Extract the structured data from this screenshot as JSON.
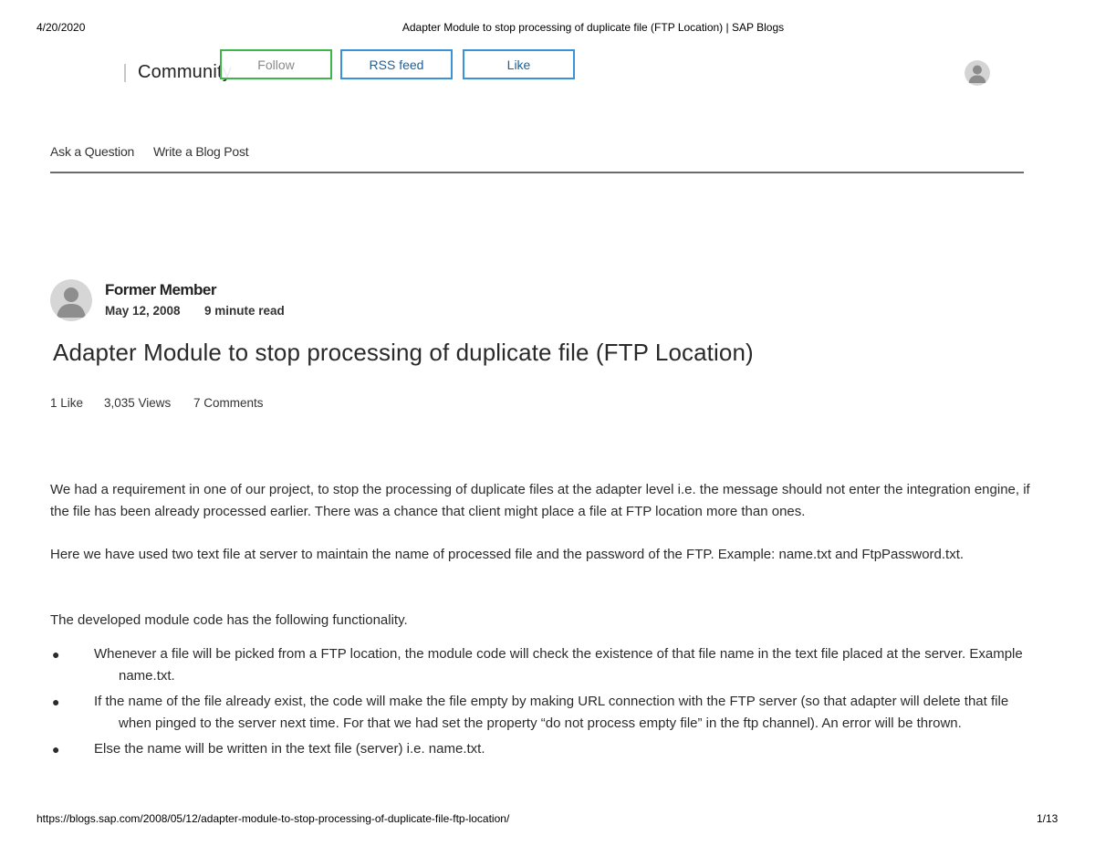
{
  "print_header": {
    "date": "4/20/2020",
    "title": "Adapter Module to stop processing of duplicate file (FTP Location) | SAP Blogs"
  },
  "print_footer": {
    "url": "https://blogs.sap.com/2008/05/12/adapter-module-to-stop-processing-of-duplicate-file-ftp-location/",
    "page": "1/13"
  },
  "topbar": {
    "brand_label": "Community",
    "follow_label": "Follow",
    "rss_label": "RSS feed",
    "like_label": "Like",
    "avatar_icon": "user-avatar-icon"
  },
  "nav": {
    "ask_label": "Ask a Question",
    "write_label": "Write a Blog Post"
  },
  "post": {
    "author": "Former Member",
    "date": "May 12, 2008",
    "read_time": "9 minute read",
    "title": "Adapter Module to stop processing of duplicate file (FTP Location)",
    "likes": "1 Like",
    "views": "3,035 Views",
    "comments": "7 Comments"
  },
  "body": {
    "para1": " We had a requirement in one of our project, to stop the processing of duplicate files at the adapter level i.e. the message should not enter  the integration engine, if the file has been already processed earlier. There was a chance that client might place a file at FTP location more than ones.",
    "para2": "Here we have used two text file at server to maintain the name of processed file and the password of the FTP. Example: name.txt and FtpPassword.txt.",
    "para3": "The developed module code has the following functionality.",
    "bullets": [
      "Whenever a file will be picked from a FTP location, the module code will check the existence of that file name in the text file placed at the server. Example name.txt.",
      " If the name of the file already exist, the code will make the file empty by making URL connection with the FTP server (so that adapter will delete that file when pinged to the server next time. For that we had set the property “do not process empty file” in the ftp channel). An error will be thrown.",
      "Else the name will be written in the text file (server) i.e. name.txt."
    ]
  },
  "colors": {
    "follow_border": "#3db54a",
    "button_border": "#3a93d6",
    "nav_rule": "#6b6b6b"
  }
}
